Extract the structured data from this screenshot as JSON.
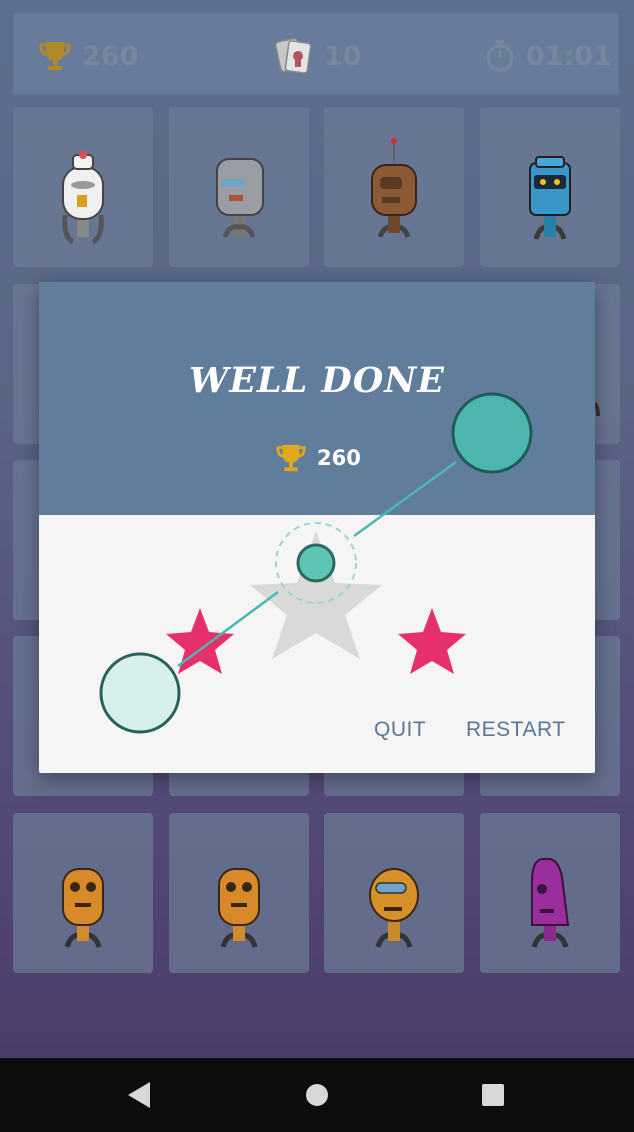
{
  "stats": {
    "score": "260",
    "moves": "10",
    "time": "01:01",
    "score_icon": "trophy-icon",
    "moves_icon": "cards-icon",
    "time_icon": "stopwatch-icon"
  },
  "cards": [
    {
      "robot": "white-robot",
      "face_up": true
    },
    {
      "robot": "gray-robot",
      "face_up": true
    },
    {
      "robot": "brown-robot",
      "face_up": true
    },
    {
      "robot": "blue-robot",
      "face_up": true
    },
    {
      "robot": "orange-robot",
      "face_up": true
    },
    {
      "robot": "orange-robot",
      "face_up": true
    },
    {
      "robot": "orange-goggle-robot",
      "face_up": true
    },
    {
      "robot": "purple-robot",
      "face_up": true
    }
  ],
  "dialog": {
    "title": "WELL DONE",
    "score": "260",
    "stars_earned": 2,
    "stars_total": 3,
    "quit_label": "QUIT",
    "restart_label": "RESTART"
  },
  "colors": {
    "header": "#607d9c",
    "star_on": "#e6306c",
    "star_off": "#d9d9d9",
    "trophy": "#d9a21b",
    "button_text": "#5a7896"
  },
  "navbar": {
    "back_icon": "back-triangle-icon",
    "home_icon": "home-circle-icon",
    "recents_icon": "recents-square-icon"
  }
}
